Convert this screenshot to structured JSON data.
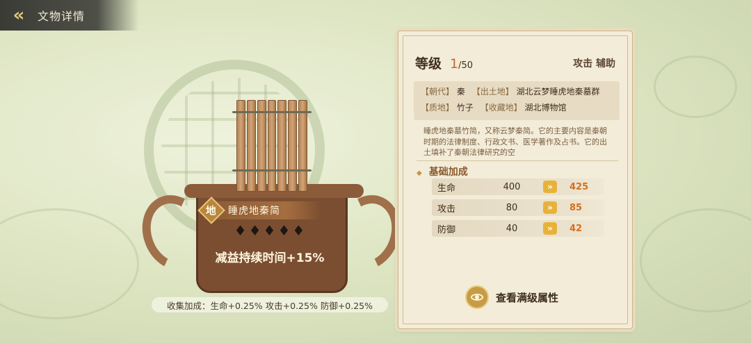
{
  "header": {
    "title": "文物详情",
    "back_icon": "chevron-left-icon"
  },
  "artifact": {
    "tier": "地",
    "name": "睡虎地秦简",
    "stars": "♦♦♦♦♦",
    "star_count": 5,
    "effect": "减益持续时间+15%",
    "collect_bonus": "收集加成：生命+0.25% 攻击+0.25% 防御+0.25%"
  },
  "panel": {
    "level_label": "等级",
    "level_current": "1",
    "level_max": "/50",
    "roles": "攻击 辅助",
    "meta": {
      "dynasty_key": "【朝代】",
      "dynasty_val": "秦",
      "origin_key": "【出土地】",
      "origin_val": "湖北云梦睡虎地秦墓群",
      "material_key": "【质地】",
      "material_val": "竹子",
      "museum_key": "【收藏地】",
      "museum_val": "湖北博物馆"
    },
    "description": "睡虎地秦墓竹简，又称云梦秦简。它的主要内容是秦朝时期的法律制度、行政文书、医学著作及占书。它的出土填补了秦朝法律研究的空",
    "base_title": "基础加成",
    "stats": [
      {
        "name": "生命",
        "old": "400",
        "new": "425"
      },
      {
        "name": "攻击",
        "old": "80",
        "new": "85"
      },
      {
        "name": "防御",
        "old": "40",
        "new": "42"
      }
    ],
    "max_button": "查看满级属性"
  },
  "colors": {
    "accent": "#d46f1c",
    "gold": "#e8b23a",
    "wood": "#7b4e31"
  }
}
